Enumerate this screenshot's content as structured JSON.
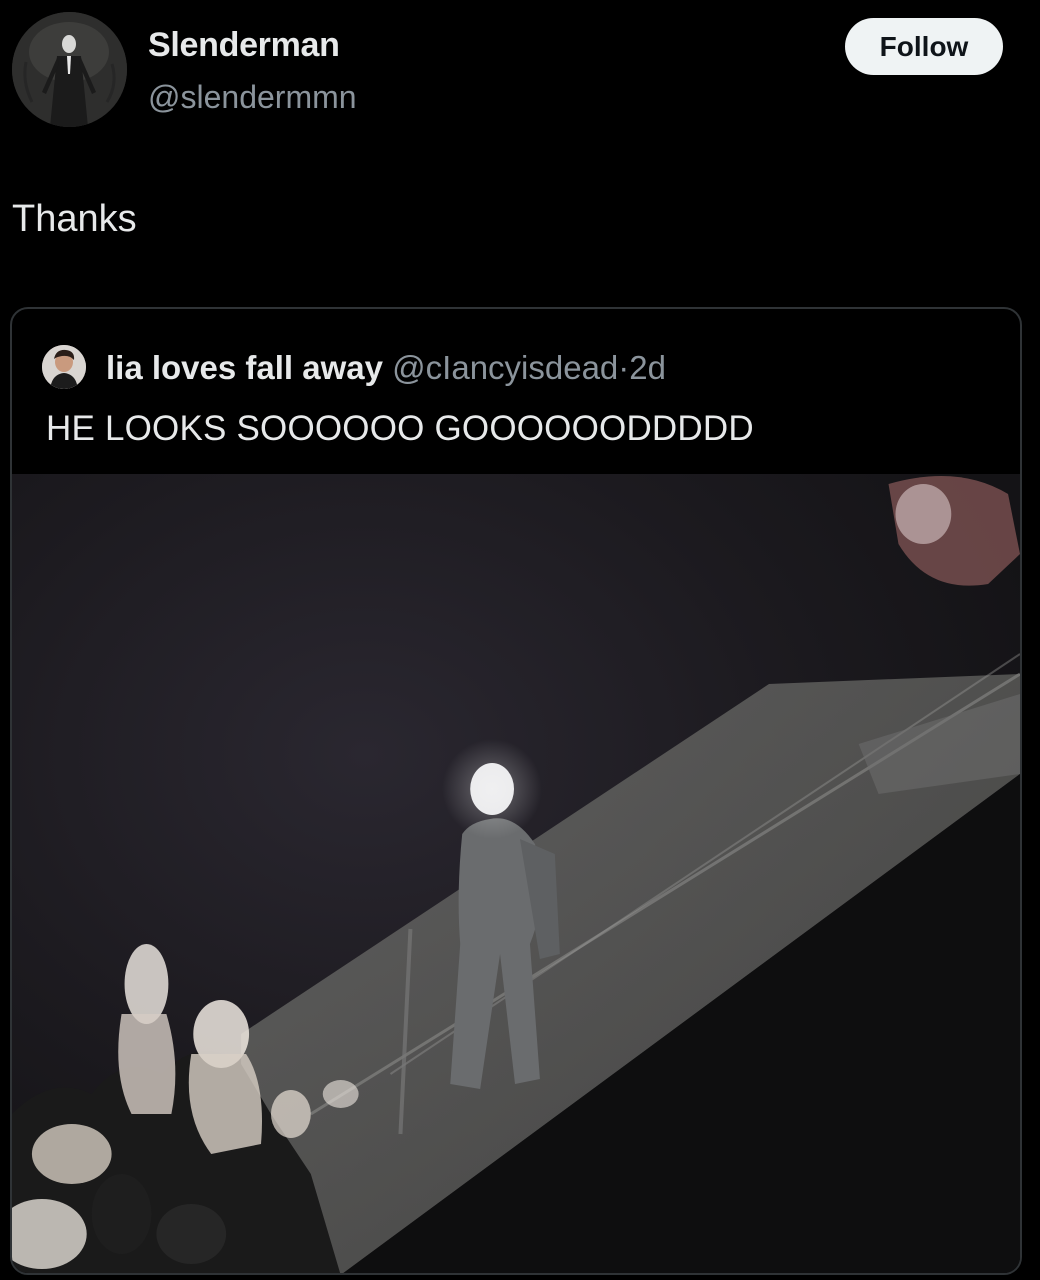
{
  "author": {
    "display_name": "Slenderman",
    "handle": "@slendermmn",
    "avatar_icon": "slenderman-avatar"
  },
  "follow_label": "Follow",
  "tweet": {
    "text": "Thanks"
  },
  "quoted": {
    "display_name": "lia loves fall away",
    "handle": "@cIancyisdead",
    "dot": "·",
    "time": "2d",
    "text": "HE LOOKS SOOOOOO GOOOOOODDDDD",
    "media_icon": "concert-video-still"
  },
  "colors": {
    "background": "#000000",
    "text_primary": "#e7e9ea",
    "text_secondary": "#8b949c",
    "follow_button_bg": "#eff3f4",
    "card_border": "#2f3336"
  }
}
